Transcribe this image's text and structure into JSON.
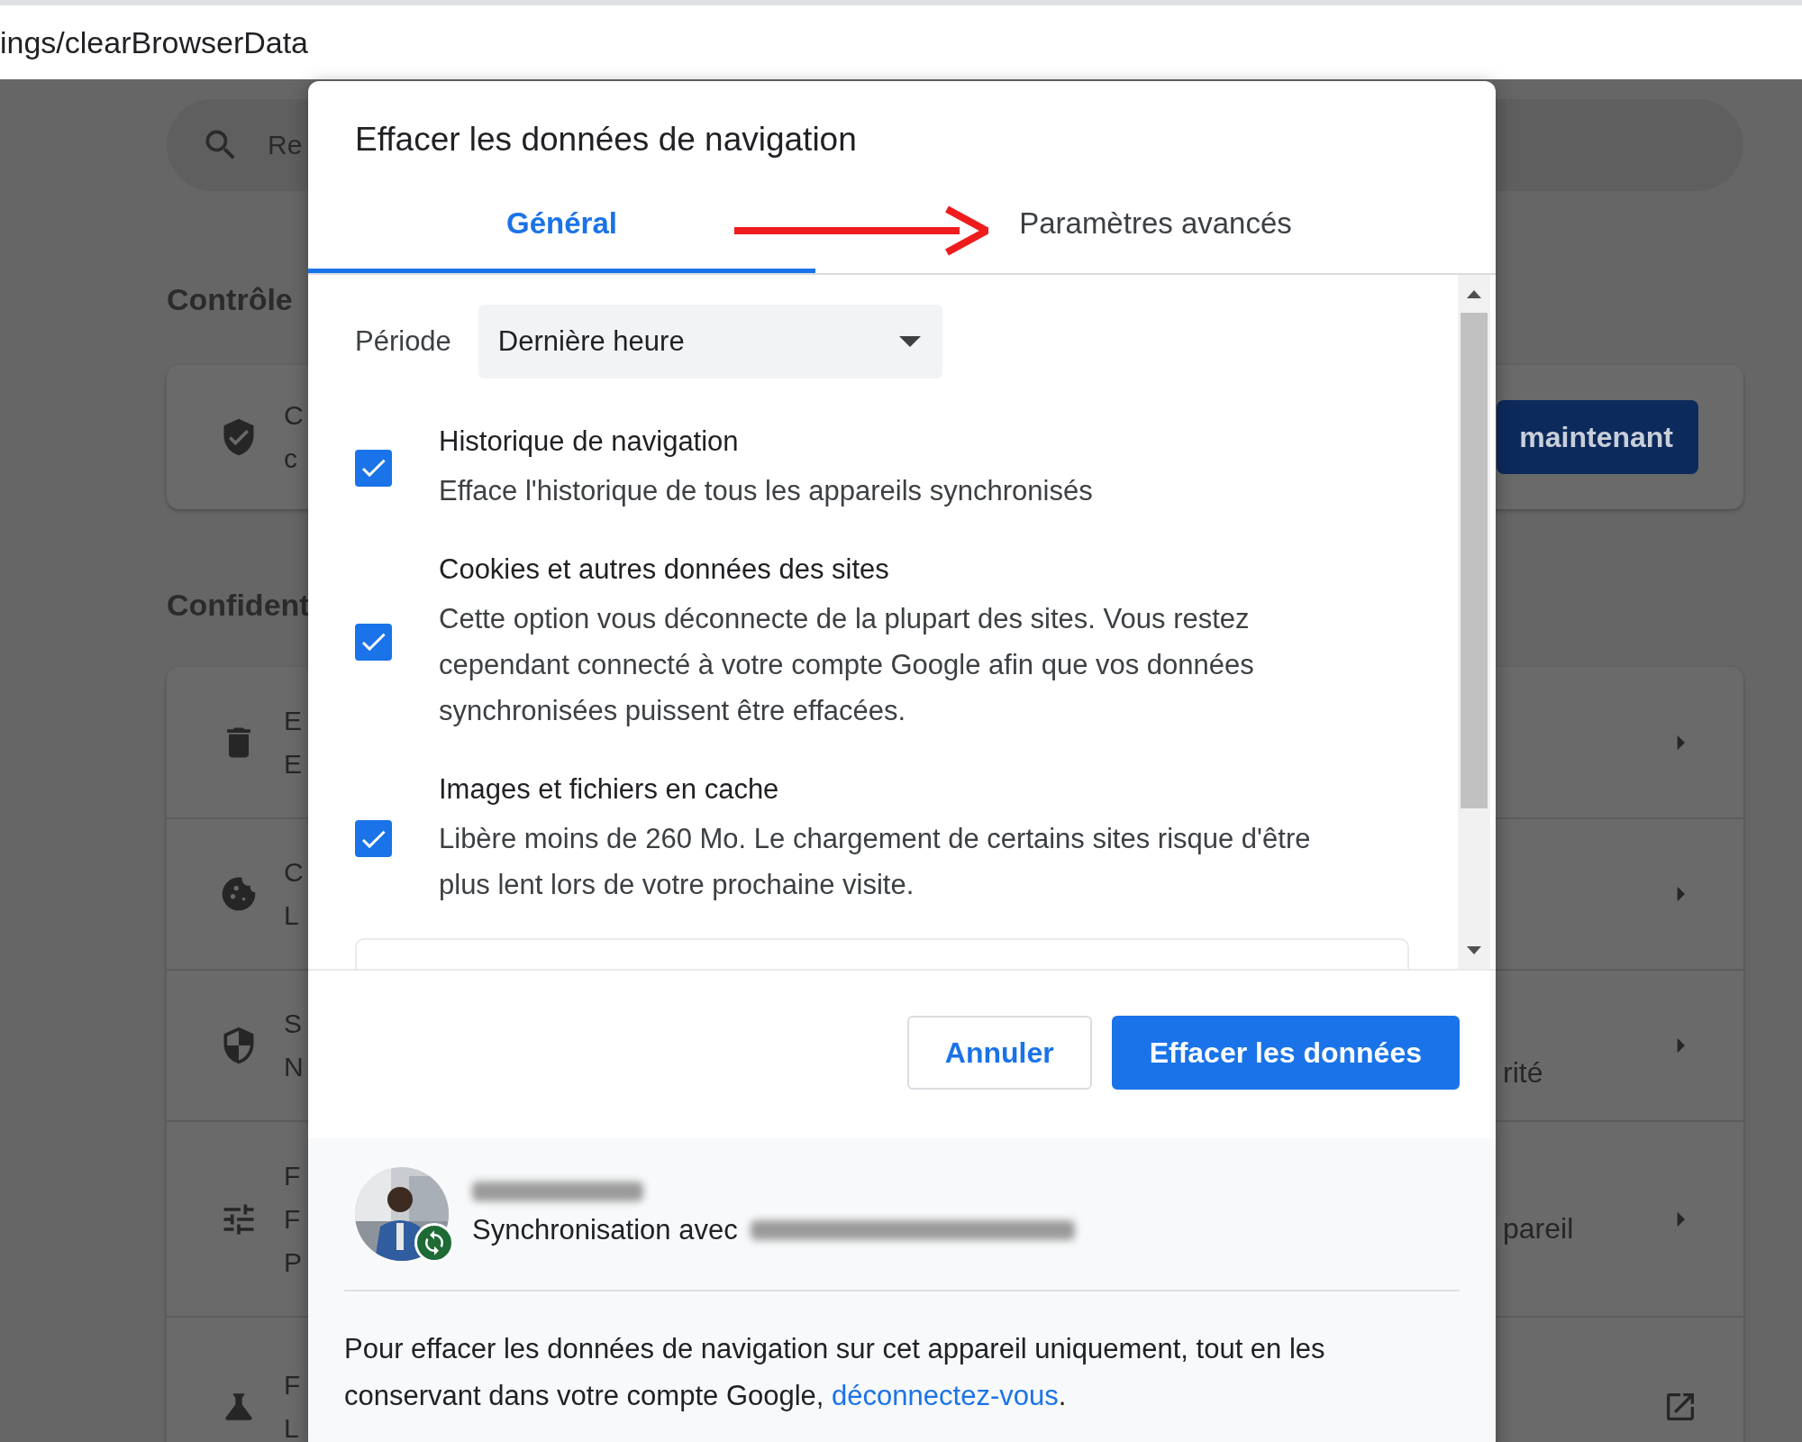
{
  "address_bar": {
    "url": "ings/clearBrowserData"
  },
  "background": {
    "search": {
      "placeholder": "Re"
    },
    "heading_1": "Contrôle",
    "safety_card": {
      "lines": [
        "C",
        "c"
      ],
      "button": "maintenant"
    },
    "heading_2": "Confident",
    "rows": [
      {
        "lines": [
          "E",
          "E"
        ]
      },
      {
        "lines": [
          "C",
          "L"
        ]
      },
      {
        "lines": [
          "S",
          "N"
        ],
        "trailing_text": "rité"
      },
      {
        "lines": [
          "F",
          "F",
          "P"
        ],
        "trailing_text": "pareil"
      },
      {
        "lines": [
          "F",
          "L"
        ]
      }
    ]
  },
  "dialog": {
    "title": "Effacer les données de navigation",
    "tabs": [
      {
        "label": "Général",
        "selected": true
      },
      {
        "label": "Paramètres avancés",
        "selected": false
      }
    ],
    "period": {
      "label": "Période",
      "value": "Dernière heure"
    },
    "options": [
      {
        "title": "Historique de navigation",
        "description": "Efface l'historique de tous les appareils synchronisés",
        "checked": true
      },
      {
        "title": "Cookies et autres données des sites",
        "description": "Cette option vous déconnecte de la plupart des sites. Vous restez cependant connecté à votre compte Google afin que vos données synchronisées puissent être effacées.",
        "checked": true
      },
      {
        "title": "Images et fichiers en cache",
        "description": "Libère moins de 260 Mo. Le chargement de certains sites risque d'être plus lent lors de votre prochaine visite.",
        "checked": true
      }
    ],
    "buttons": [
      {
        "label": "Annuler",
        "kind": "secondary"
      },
      {
        "label": "Effacer les données",
        "kind": "primary"
      }
    ],
    "account": {
      "sync_label": "Synchronisation avec"
    },
    "note": {
      "text": "Pour effacer les données de navigation sur cet appareil uniquement, tout en les conservant dans votre compte Google, ",
      "link": "déconnectez-vous",
      "end": "."
    }
  }
}
